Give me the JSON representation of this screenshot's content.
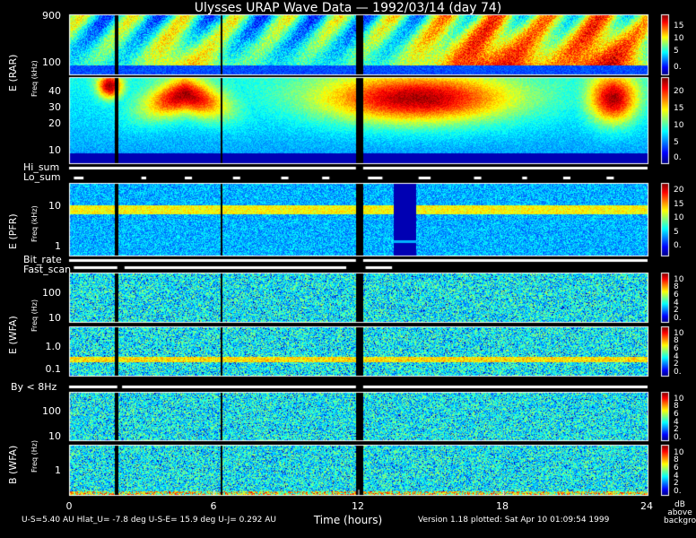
{
  "title": "Ulysses URAP Wave Data — 1992/03/14  (day 74)",
  "x_axis_label": "Time (hours)",
  "x_ticks": [
    "0",
    "6",
    "12",
    "18",
    "24"
  ],
  "footer": {
    "left": "U-S=5.40 AU   Hlat_U= -7.8 deg   U-S-E= 15.9 deg   U-J= 0.292 AU",
    "right": "Version 1.18 plotted: Sat Apr 10 01:09:54 1999"
  },
  "colorbar_unit": [
    "dB",
    "above",
    "background"
  ],
  "strip_labels": {
    "hi_sum": "Hi_sum",
    "lo_sum": "Lo_sum",
    "bit_rate": "Bit_rate",
    "fast_scan": "Fast_scan",
    "by": "By < 8Hz"
  },
  "panel_labels": {
    "rar": "E  (RAR)",
    "pfr": "E  (PFR)",
    "wfa_e": "E  (WFA)",
    "wfa_b": "B  (WFA)",
    "freq_khz": "Freq (kHz)",
    "freq_hz": "Freq (Hz)"
  },
  "chart_data": {
    "type": "heatmap",
    "title": "Ulysses URAP Wave Data — 1992/03/14  (day 74)",
    "xlabel": "Time (hours)",
    "xlim": [
      0,
      24
    ],
    "x_ticks": [
      0,
      6,
      12,
      18,
      24
    ],
    "data_gap_hours": [
      11.9,
      12.2
    ],
    "panels": [
      {
        "id": "rar_high",
        "group": "E (RAR)",
        "ylabel": "Freq (kHz)",
        "y_ticks": [
          "900",
          "100"
        ],
        "scale": "log",
        "colorbar": [
          0,
          15
        ],
        "colorbar_ticks": [
          "15",
          "10",
          "5",
          "0."
        ]
      },
      {
        "id": "rar_low",
        "group": "E (RAR)",
        "ylabel": "Freq (kHz)",
        "y_ticks": [
          "40",
          "30",
          "20",
          "10"
        ],
        "ylim": [
          0,
          48
        ],
        "scale": "linear",
        "colorbar": [
          0,
          20
        ],
        "colorbar_ticks": [
          "20",
          "15",
          "10",
          "5",
          "0."
        ]
      },
      {
        "id": "pfr",
        "group": "E (PFR)",
        "ylabel": "Freq (kHz)",
        "y_ticks": [
          "10",
          "1"
        ],
        "scale": "log",
        "colorbar": [
          0,
          20
        ],
        "colorbar_ticks": [
          "20",
          "15",
          "10",
          "5",
          "0."
        ]
      },
      {
        "id": "wfa_e_high",
        "group": "E (WFA)",
        "ylabel": "Freq (Hz)",
        "y_ticks": [
          "100",
          "10"
        ],
        "scale": "log",
        "colorbar": [
          0,
          10
        ],
        "colorbar_ticks": [
          "10",
          "8",
          "6",
          "4",
          "2",
          "0."
        ]
      },
      {
        "id": "wfa_e_low",
        "group": "E (WFA)",
        "ylabel": "Freq (Hz)",
        "y_ticks": [
          "1.0",
          "0.1"
        ],
        "scale": "log",
        "colorbar": [
          0,
          10
        ],
        "colorbar_ticks": [
          "10",
          "8",
          "6",
          "4",
          "2",
          "0."
        ]
      },
      {
        "id": "wfa_b_high",
        "group": "B (WFA)",
        "ylabel": "Freq (Hz)",
        "y_ticks": [
          "100",
          "10"
        ],
        "scale": "log",
        "colorbar": [
          0,
          10
        ],
        "colorbar_ticks": [
          "10",
          "8",
          "6",
          "4",
          "2",
          "0."
        ]
      },
      {
        "id": "wfa_b_low",
        "group": "B (WFA)",
        "ylabel": "Freq (Hz)",
        "y_ticks": [
          "1"
        ],
        "scale": "log",
        "colorbar": [
          0,
          10
        ],
        "colorbar_ticks": [
          "10",
          "8",
          "6",
          "4",
          "2",
          "0."
        ]
      }
    ]
  }
}
